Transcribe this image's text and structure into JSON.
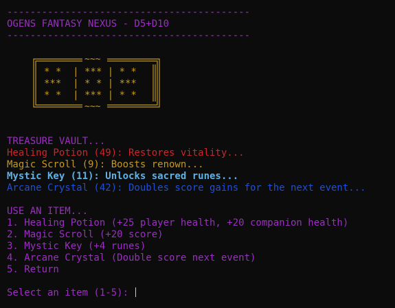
{
  "header": {
    "rule": "------------------------------------------",
    "title": "OGENS FANTASY NEXUS - D5+D10"
  },
  "vault_art": {
    "top_tilde": "~~~",
    "bottom_tilde": "~~~",
    "rows": [
      "* *  | *** | * *",
      "***  | * * | ***",
      "* *  | *** | * *"
    ]
  },
  "treasure": {
    "heading": "TREASURE VAULT...",
    "items": [
      "Healing Potion (49): Restores vitality...",
      "Magic Scroll (9): Boosts renown...",
      "Mystic Key (11): Unlocks sacred runes...",
      "Arcane Crystal (42): Doubles score gains for the next event..."
    ]
  },
  "menu": {
    "heading": "USE AN ITEM...",
    "options": [
      "1. Healing Potion (+25 player health, +20 companion health)",
      "2. Magic Scroll (+20 score)",
      "3. Mystic Key (+4 runes)",
      "4. Arcane Crystal (Double score next event)",
      "5. Return"
    ]
  },
  "prompt": {
    "label": "Select an item (1-5): "
  },
  "colors": {
    "background": "#0c0c0c",
    "purple": "#9a2fc0",
    "red": "#c8282d",
    "gold": "#c49a1e",
    "cyan": "#5fb2e6",
    "blue": "#1f4fd6"
  }
}
